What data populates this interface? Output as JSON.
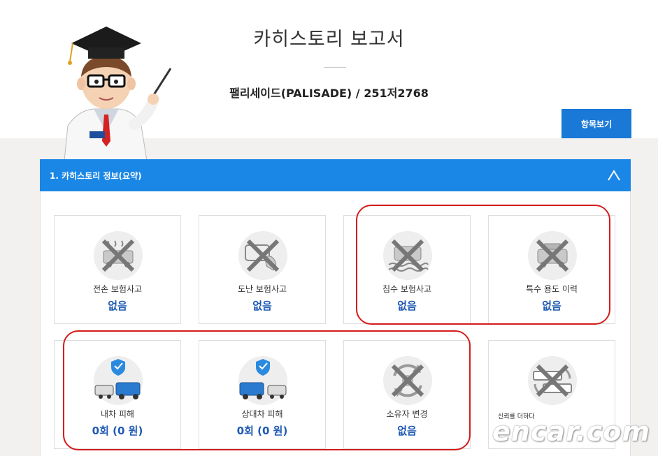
{
  "header": {
    "title": "카히스토리 보고서",
    "car": "팰리세이드(PALISADE) / 251저2768",
    "list_button": "항목보기"
  },
  "section": {
    "title": "1. 카히스토리 정보(요약)"
  },
  "cards": [
    {
      "label": "전손 보험사고",
      "value": "없음",
      "icon": "total-loss-icon"
    },
    {
      "label": "도난 보험사고",
      "value": "없음",
      "icon": "theft-icon"
    },
    {
      "label": "침수 보험사고",
      "value": "없음",
      "icon": "flood-icon"
    },
    {
      "label": "특수 용도 이력",
      "value": "없음",
      "icon": "special-use-icon"
    },
    {
      "label": "내차 피해",
      "value": "0회 (0 원)",
      "icon": "own-damage-icon"
    },
    {
      "label": "상대차 피해",
      "value": "0회 (0 원)",
      "icon": "other-damage-icon"
    },
    {
      "label": "소유자 변경",
      "value": "없음",
      "icon": "owner-change-icon"
    },
    {
      "label": "",
      "value": "",
      "icon": "plate-change-icon"
    }
  ],
  "watermark": {
    "text": "encar.com",
    "tag": "신뢰를 더하다"
  },
  "colors": {
    "accent": "#1a86e6",
    "value": "#1f5ab3",
    "highlight": "#d31c1c"
  }
}
